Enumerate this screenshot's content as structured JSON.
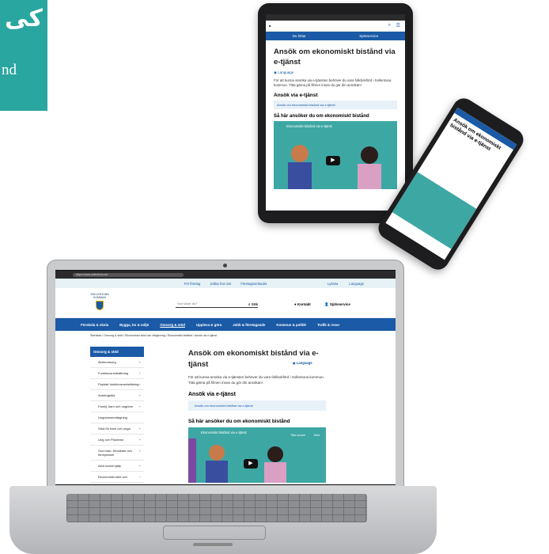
{
  "corner_card": {
    "arabic": "کی",
    "latin": "nd",
    "color": "#2aa6a1"
  },
  "tablet": {
    "title": "Ansök om ekonomiskt bistånd via e-tjänst",
    "language": "Language",
    "nav": [
      "Du hittar",
      "Självservice"
    ],
    "paragraph": "För att kunna ansöka via e-tjänsten behöver du vara folkbokförd i Sollentuna kommun. Titta gärna på filmen innan du gör din ansökan!",
    "h2": "Ansök via e-tjänst",
    "link": "Ansök om ekonomiskt bistånd via e-tjänst",
    "h3": "Så här ansöker du om ekonomiskt bistånd",
    "video_title": "Ekonomiskt bistånd via e-tjänst"
  },
  "phone": {
    "title": "Ansök om ekonomiskt bistånd via e-tjänst"
  },
  "laptop": {
    "url": "https://www.sollentuna.se/",
    "top_links": [
      "För företag",
      "Jobba hos oss",
      "Företagsombudet"
    ],
    "top_right": [
      "Lyssna",
      "Language"
    ],
    "logo_text": "SOLLENTUNA KOMMUN",
    "search_placeholder": "Vad söker du?",
    "search_button": "Sök",
    "kontakt": "Kontakt",
    "sjalvservice": "Självservice",
    "main_nav": [
      "Förskola & skola",
      "Bygga, bo & miljö",
      "Omsorg & stöd",
      "Uppleva & göra",
      "Jobb & företagande",
      "Kommun & politik",
      "Trafik & resor"
    ],
    "breadcrumb": "Startsida / Omsorg & stöd / Ekonomiskt stöd och rådgivning / Ekonomiskt bistånd / Ansök via e-tjänst",
    "side_header": "Omsorg & stöd",
    "side_items": [
      "Äldreomsorg",
      "Funktionsnedsättning",
      "Psykisk funktionsnedsättning",
      "Anhörigstöd",
      "Familj, barn och ungdom",
      "Ungdomsmottagning",
      "Stöd för barn och unga",
      "Ung och Placerad",
      "God man, förvaltare och förmyndare",
      "Akut social hjälp",
      "Ekonomiskt stöd och"
    ],
    "title": "Ansök om ekonomiskt bistånd via e-tjänst",
    "language": "Language",
    "paragraph": "För att kunna ansöka via e-tjänsten behöver du vara folkbokförd i Sollentuna kommun. Titta gärna på filmen innan du gör din ansökan!",
    "h2": "Ansök via e-tjänst",
    "link": "Ansök om ekonomiskt bistånd via e-tjänst",
    "h3": "Så här ansöker du om ekonomiskt bistånd",
    "video_title": "Ekonomiskt bistånd via e-tjänst",
    "video_actions": [
      "Titta senare",
      "Dela"
    ]
  }
}
